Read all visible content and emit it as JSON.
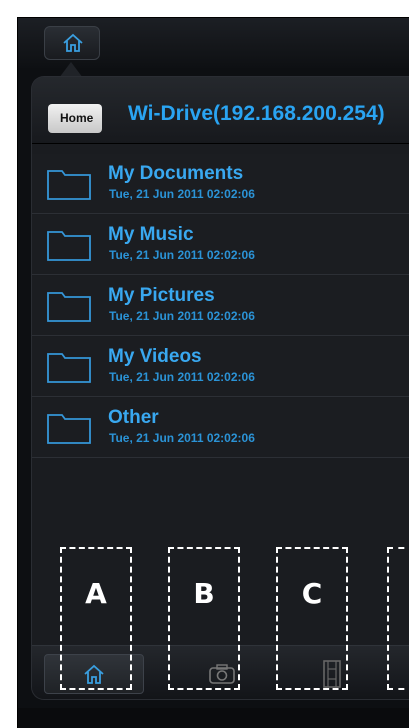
{
  "header": {
    "breadcrumb": "Home",
    "title": "Wi-Drive(192.168.200.254)"
  },
  "items": [
    {
      "name": "My Documents",
      "date": "Tue, 21 Jun 2011 02:02:06",
      "icon": "folder-icon"
    },
    {
      "name": "My Music",
      "date": "Tue, 21 Jun 2011 02:02:06",
      "icon": "folder-icon"
    },
    {
      "name": "My Pictures",
      "date": "Tue, 21 Jun 2011 02:02:06",
      "icon": "folder-icon"
    },
    {
      "name": "My Videos",
      "date": "Tue, 21 Jun 2011 02:02:06",
      "icon": "folder-icon"
    },
    {
      "name": "Other",
      "date": "Tue, 21 Jun 2011 02:02:06",
      "icon": "folder-icon"
    }
  ],
  "bottom_tabs": [
    {
      "icon": "home-icon",
      "active": true
    },
    {
      "icon": "camera-icon",
      "active": false
    },
    {
      "icon": "film-icon",
      "active": false
    }
  ],
  "callouts": [
    "A",
    "B",
    "C"
  ],
  "colors": {
    "accent": "#2aa4f2",
    "date": "#2b93d6",
    "background": "#0d0f12"
  }
}
